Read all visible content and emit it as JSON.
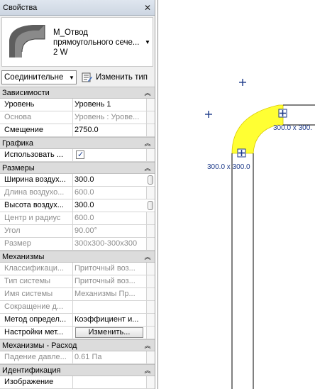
{
  "panel": {
    "title": "Свойства",
    "close": "✕"
  },
  "type_selector": {
    "family": "М_Отвод",
    "type_line": "прямоугольного сече...",
    "size": "2 W"
  },
  "filter": {
    "selected": "Соединительне",
    "edit_type_label": "Изменить тип"
  },
  "categories": {
    "constraints": "Зависимости",
    "graphics": "Графика",
    "dimensions": "Размеры",
    "mechanical": "Механизмы",
    "mechanical_flow": "Механизмы - Расход",
    "identity": "Идентификация"
  },
  "rows": {
    "level": {
      "label": "Уровень",
      "value": "Уровень 1"
    },
    "host": {
      "label": "Основа",
      "value": "Уровень : Урове..."
    },
    "offset": {
      "label": "Смещение",
      "value": "2750.0"
    },
    "use_annot": {
      "label": "Использовать ..."
    },
    "duct_width": {
      "label": "Ширина воздух...",
      "value": "300.0"
    },
    "duct_length": {
      "label": "Длина воздухо...",
      "value": "600.0"
    },
    "duct_height": {
      "label": "Высота воздух...",
      "value": "300.0"
    },
    "center_radius": {
      "label": "Центр и радиус",
      "value": "600.0"
    },
    "angle": {
      "label": "Угол",
      "value": "90.00°"
    },
    "size": {
      "label": "Размер",
      "value": "300x300-300x300"
    },
    "classification": {
      "label": "Классификаци...",
      "value": "Приточный воз..."
    },
    "system_type": {
      "label": "Тип системы",
      "value": "Приточный воз..."
    },
    "system_name": {
      "label": "Имя системы",
      "value": "Механизмы Пр..."
    },
    "abbreviation": {
      "label": "Сокращение д...",
      "value": ""
    },
    "loss_method": {
      "label": "Метод определ...",
      "value": "Коэффициент и..."
    },
    "loss_settings": {
      "label": "Настройки мет...",
      "button": "Изменить..."
    },
    "pressure_drop": {
      "label": "Падение давле...",
      "value": "0.61 Па"
    },
    "image": {
      "label": "Изображение",
      "value": ""
    }
  },
  "canvas": {
    "dim_lower": "300.0 x 300.0",
    "dim_upper": "300.0 x 300.",
    "fitting_color": "#ffff33",
    "annotation_color": "#1d3a8a"
  },
  "chevron": "︽",
  "dropdown_arrow": "▼"
}
